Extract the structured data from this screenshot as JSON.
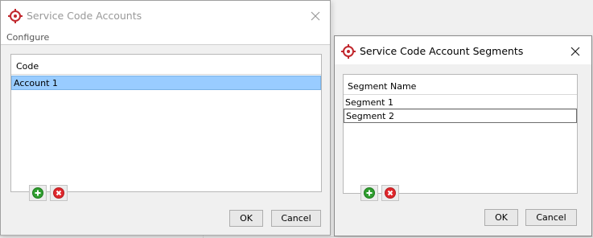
{
  "accounts_dialog": {
    "title": "Service Code Accounts",
    "subtitle": "Configure",
    "column_header": "Code",
    "rows": [
      "Account 1"
    ],
    "ok_label": "OK",
    "cancel_label": "Cancel",
    "icons": {
      "app": "target-icon",
      "close": "close-icon",
      "add": "add-icon",
      "remove": "remove-icon"
    }
  },
  "segments_dialog": {
    "title": "Service Code Account Segments",
    "column_header": "Segment Name",
    "rows": [
      "Segment 1",
      "Segment 2"
    ],
    "ok_label": "OK",
    "cancel_label": "Cancel",
    "icons": {
      "app": "target-icon",
      "close": "close-icon",
      "add": "add-icon",
      "remove": "remove-icon"
    }
  },
  "colors": {
    "selection": "#99ccff",
    "brand": "#c1272d",
    "add": "#2f9e2f",
    "remove": "#e0262b"
  }
}
